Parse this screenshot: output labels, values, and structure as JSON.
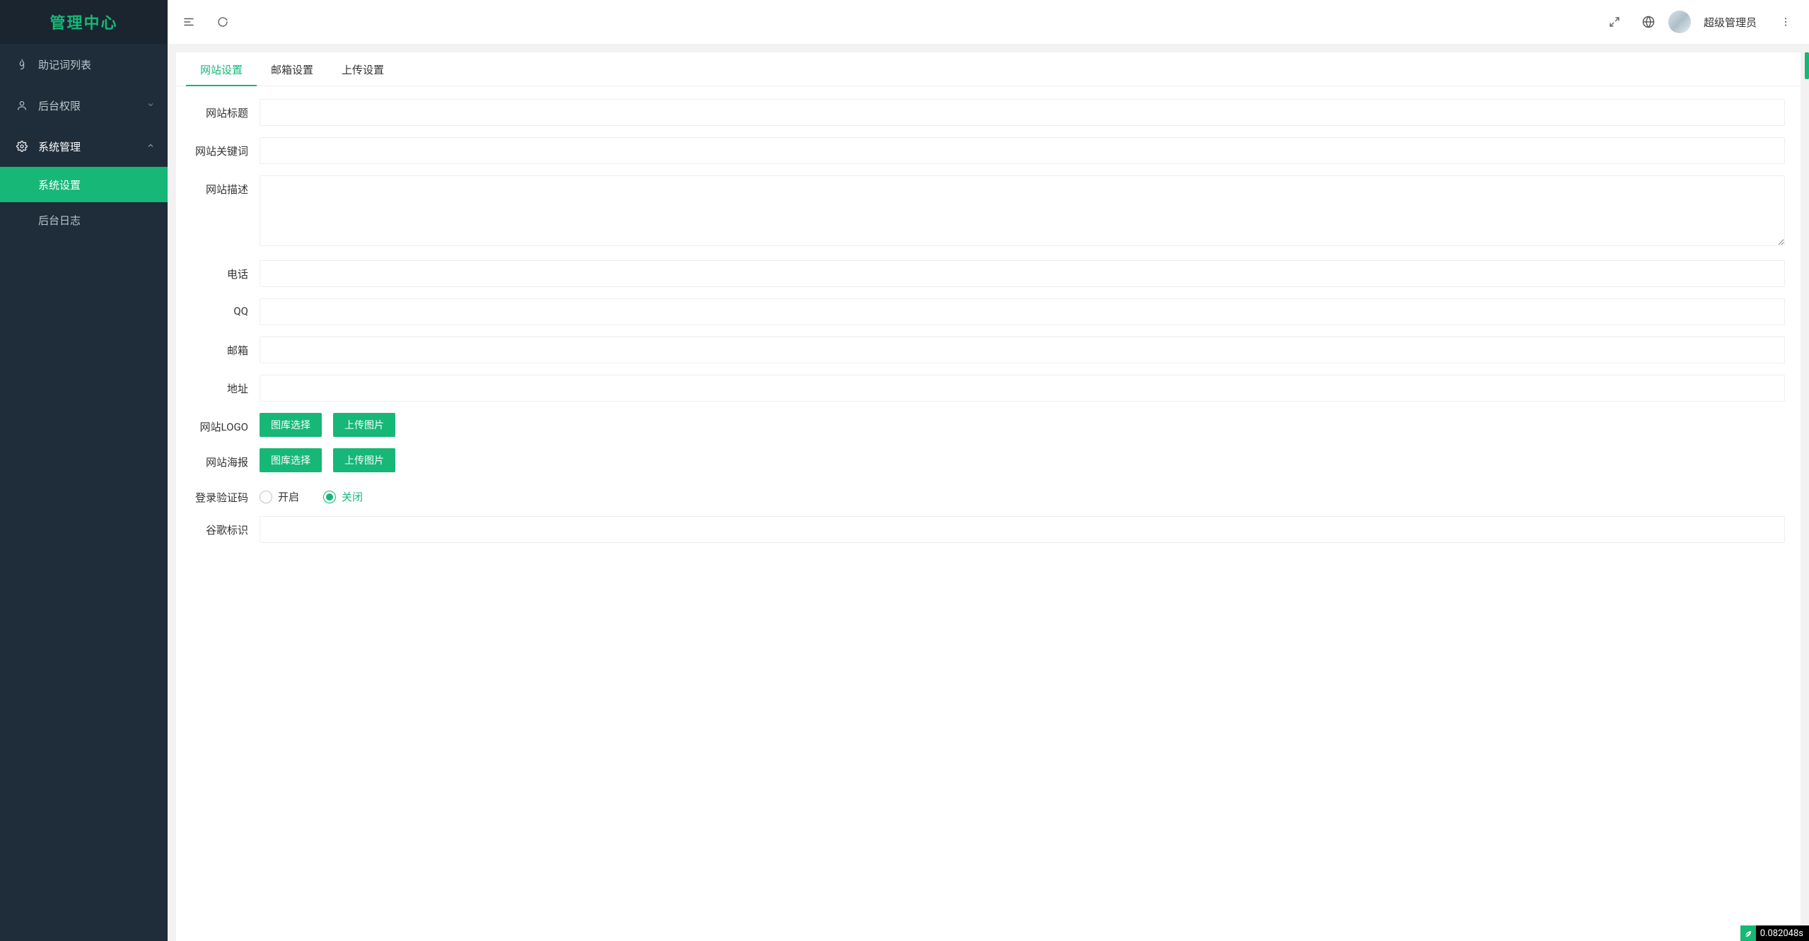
{
  "sidebar": {
    "logo": "管理中心",
    "items": [
      {
        "icon": "flame",
        "label": "助记词列表",
        "expandable": false
      },
      {
        "icon": "user",
        "label": "后台权限",
        "expandable": true,
        "expanded": false
      },
      {
        "icon": "gear",
        "label": "系统管理",
        "expandable": true,
        "expanded": true,
        "children": [
          {
            "label": "系统设置",
            "active": true
          },
          {
            "label": "后台日志",
            "active": false
          }
        ]
      }
    ]
  },
  "header": {
    "username": "超级管理员"
  },
  "tabs": [
    {
      "label": "网站设置",
      "active": true
    },
    {
      "label": "邮箱设置",
      "active": false
    },
    {
      "label": "上传设置",
      "active": false
    }
  ],
  "form": {
    "site_title": {
      "label": "网站标题",
      "value": ""
    },
    "site_keywords": {
      "label": "网站关键词",
      "value": ""
    },
    "site_desc": {
      "label": "网站描述",
      "value": ""
    },
    "phone": {
      "label": "电话",
      "value": ""
    },
    "qq": {
      "label": "QQ",
      "value": ""
    },
    "email": {
      "label": "邮箱",
      "value": ""
    },
    "address": {
      "label": "地址",
      "value": ""
    },
    "site_logo": {
      "label": "网站LOGO"
    },
    "site_poster": {
      "label": "网站海报"
    },
    "login_captcha": {
      "label": "登录验证码",
      "options": {
        "on": "开启",
        "off": "关闭"
      },
      "value": "off"
    },
    "google_flag": {
      "label": "谷歌标识",
      "value": ""
    },
    "btn_gallery": "图库选择",
    "btn_upload": "上传图片"
  },
  "perf": {
    "time": "0.082048s"
  }
}
